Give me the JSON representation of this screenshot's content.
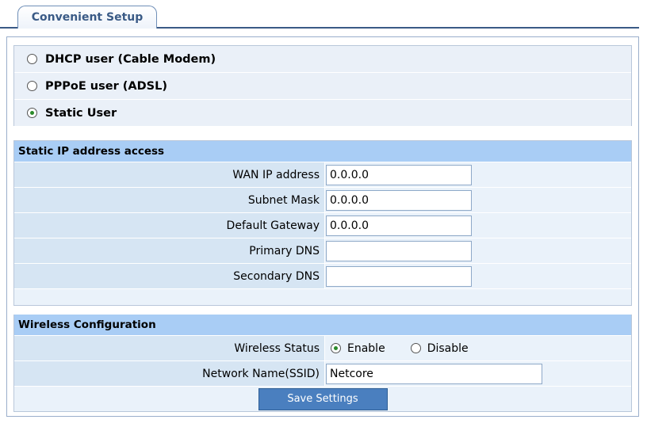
{
  "tab": {
    "title": "Convenient Setup"
  },
  "modes": [
    {
      "label": "DHCP user (Cable Modem)",
      "checked": false
    },
    {
      "label": "PPPoE user (ADSL)",
      "checked": false
    },
    {
      "label": "Static User",
      "checked": true
    }
  ],
  "static_ip": {
    "header": "Static IP address access",
    "fields": [
      {
        "label": "WAN IP address",
        "value": "0.0.0.0"
      },
      {
        "label": "Subnet Mask",
        "value": "0.0.0.0"
      },
      {
        "label": "Default Gateway",
        "value": "0.0.0.0"
      },
      {
        "label": "Primary DNS",
        "value": ""
      },
      {
        "label": "Secondary DNS",
        "value": ""
      }
    ]
  },
  "wireless": {
    "header": "Wireless Configuration",
    "status_label": "Wireless Status",
    "enable_label": "Enable",
    "disable_label": "Disable",
    "selected": "Enable",
    "ssid_label": "Network Name(SSID)",
    "ssid_value": "Netcore"
  },
  "save_button": "Save Settings"
}
